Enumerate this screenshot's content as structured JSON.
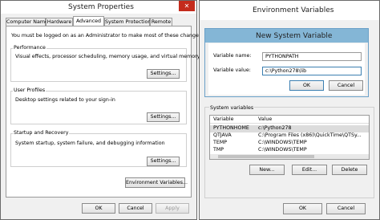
{
  "system_properties": {
    "title": "System Properties",
    "tabs": [
      "Computer Name",
      "Hardware",
      "Advanced",
      "System Protection",
      "Remote"
    ],
    "admin_note": "You must be logged on as an Administrator to make most of these changes.",
    "performance": {
      "label": "Performance",
      "desc": "Visual effects, processor scheduling, memory usage, and virtual memory",
      "button": "Settings..."
    },
    "user_profiles": {
      "label": "User Profiles",
      "desc": "Desktop settings related to your sign-in",
      "button": "Settings..."
    },
    "startup_recovery": {
      "label": "Startup and Recovery",
      "desc": "System startup, system failure, and debugging information",
      "button": "Settings..."
    },
    "env_button": "Environment Variables...",
    "ok": "OK",
    "cancel": "Cancel",
    "apply": "Apply"
  },
  "environment_variables": {
    "title": "Environment Variables",
    "system_label": "System variables",
    "columns": [
      "Variable",
      "Value"
    ],
    "rows": [
      {
        "variable": "PYTHONHOME",
        "value": "c:\\Python278"
      },
      {
        "variable": "QTJAVA",
        "value": "C:\\Program Files (x86)\\QuickTime\\QTSy..."
      },
      {
        "variable": "TEMP",
        "value": "C:\\WINDOWS\\TEMP"
      },
      {
        "variable": "TMP",
        "value": "C:\\WINDOWS\\TEMP"
      }
    ],
    "new": "New...",
    "edit": "Edit...",
    "delete": "Delete",
    "ok": "OK",
    "cancel": "Cancel"
  },
  "new_system_variable": {
    "title": "New System Variable",
    "name_label": "Variable name:",
    "name_value": "PYTHONPATH",
    "value_label": "Variable value:",
    "value_value": "c:\\Python278\\lib",
    "ok": "OK",
    "cancel": "Cancel"
  }
}
